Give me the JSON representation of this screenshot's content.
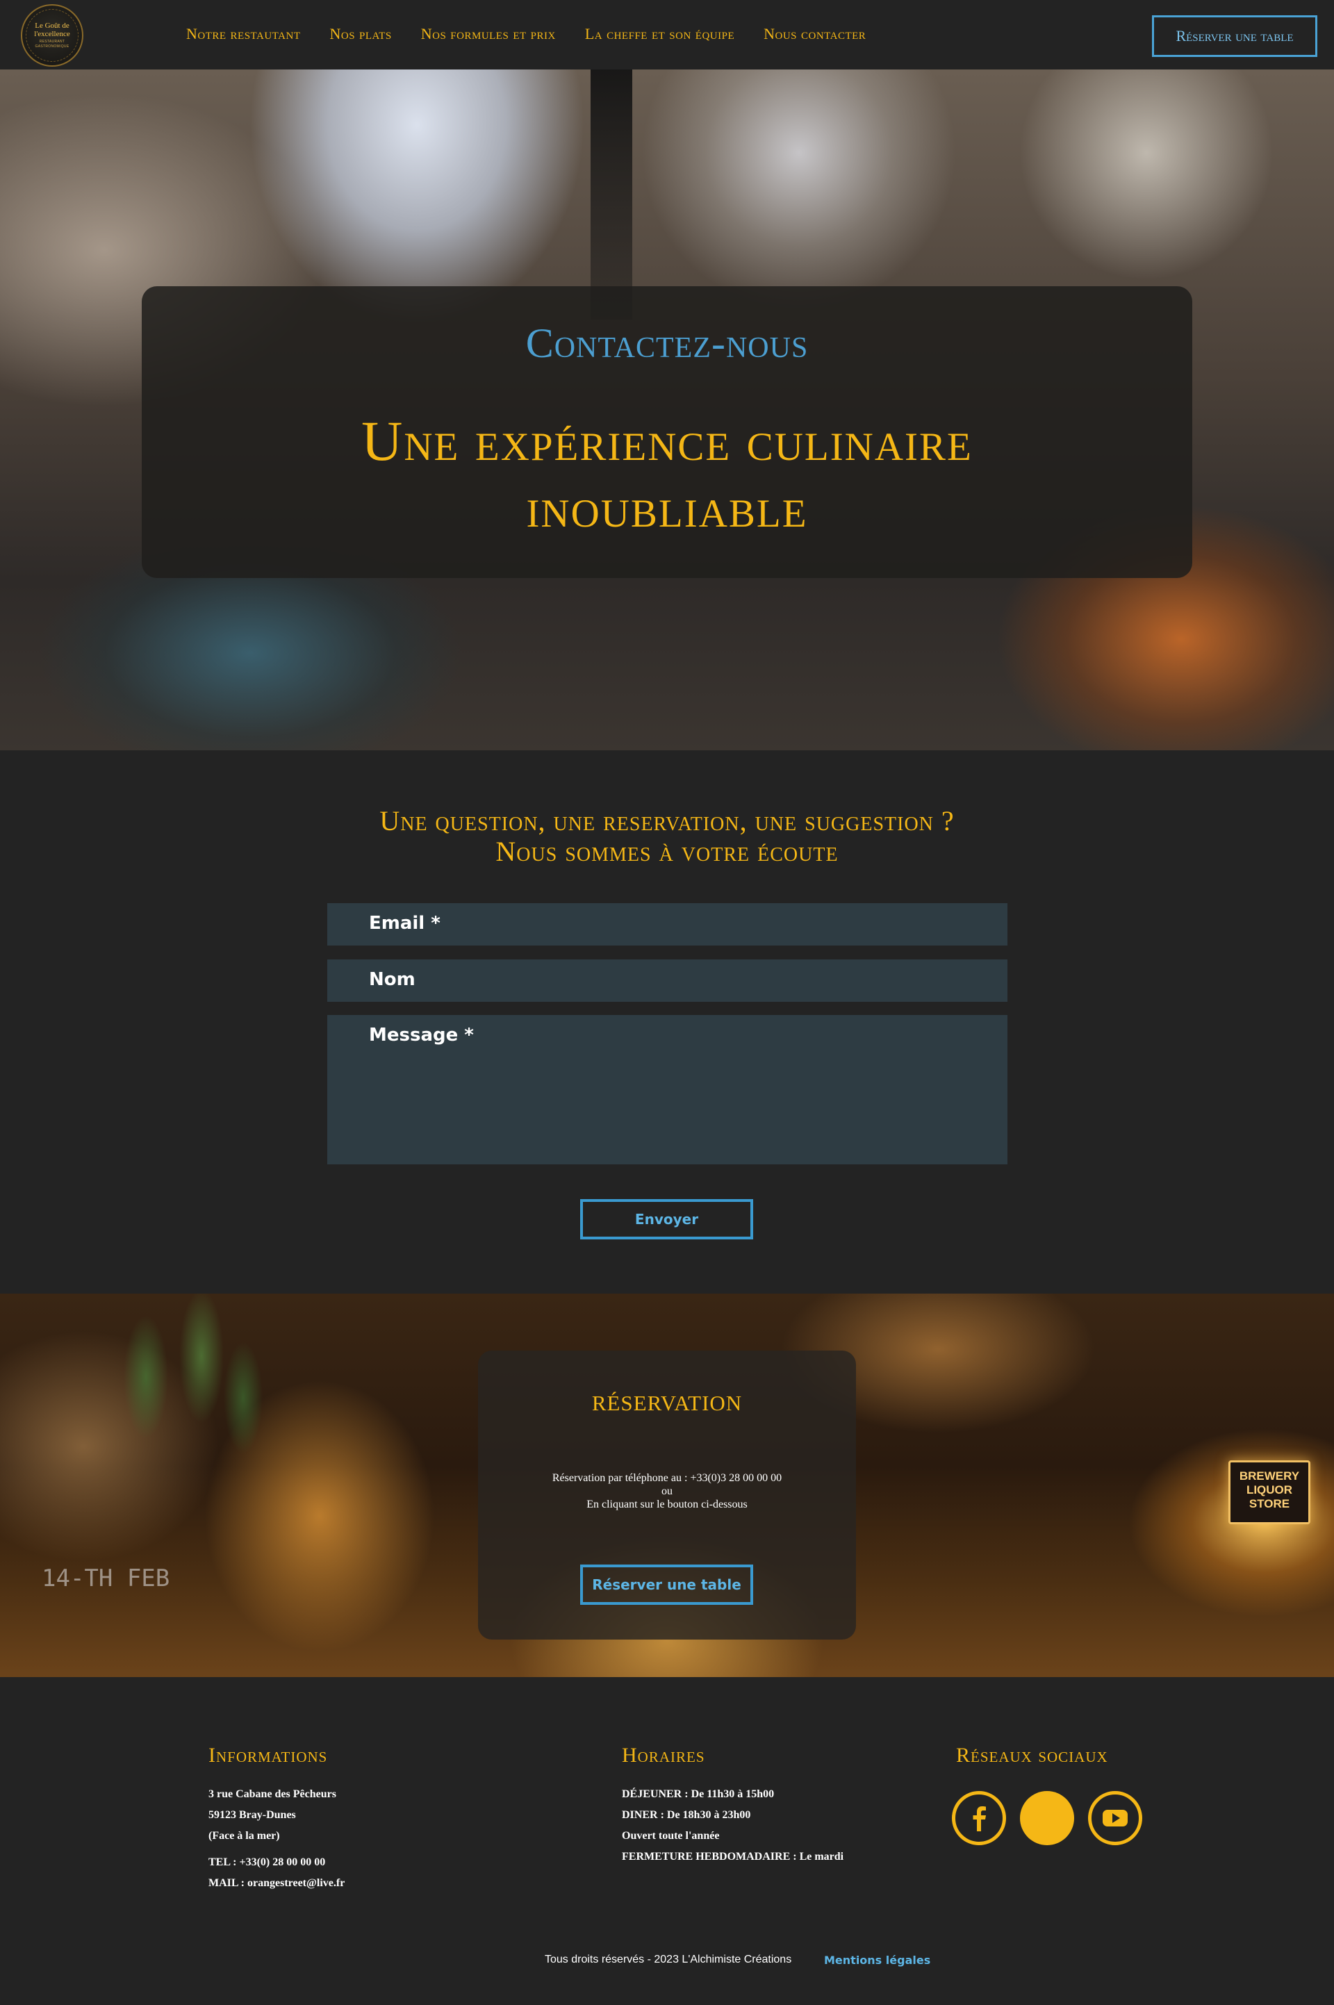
{
  "nav": {
    "logo_line1": "Le Goût de",
    "logo_line2": "l'excellence",
    "logo_tagline": "RESTAURANT GASTRONOMIQUE",
    "links": [
      "Notre restautant",
      "Nos plats",
      "Nos formules et prix",
      "La cheffe et son équipe",
      "Nous contacter"
    ],
    "cta": "Réserver une table"
  },
  "hero": {
    "kicker": "Contactez-nous",
    "title": "Une expérience culinaire inoubliable"
  },
  "contact": {
    "heading_line1": "Une question, une reservation, une suggestion ?",
    "heading_line2": "Nous sommes à votre écoute",
    "email_placeholder": "Email *",
    "name_placeholder": "Nom",
    "message_placeholder": "Message *",
    "submit": "Envoyer"
  },
  "reservation": {
    "title": "réservation",
    "line1": "Réservation par téléphone au : +33(0)3 28 00 00 00",
    "line2": "ou",
    "line3": "En cliquant sur le bouton ci-dessous",
    "button": "Réserver une table",
    "sign": "BREWERY LIQUOR STORE",
    "chalk": "14-TH FEB"
  },
  "footer": {
    "info_title": "Informations",
    "address1": "3 rue Cabane des Pêcheurs",
    "address2": "59123 Bray-Dunes",
    "address3": "(Face à la mer)",
    "tel": "TEL : +33(0) 28 00 00 00",
    "mail": "MAIL : orangestreet@live.fr",
    "hours_title": "Horaires",
    "lunch": "DÉJEUNER : De 11h30 à 15h00",
    "dinner": "DINER : De 18h30 à 23h00",
    "open": "Ouvert toute l'année",
    "closing": "FERMETURE HEBDOMADAIRE : Le mardi",
    "social_title": "Réseaux sociaux",
    "social_icons": [
      "facebook-icon",
      "instagram-icon",
      "youtube-icon"
    ],
    "copyright": "Tous droits réservés - 2023 L'Alchimiste Créations",
    "legal": "Mentions légales"
  },
  "colors": {
    "accent": "#f5b716",
    "link": "#4aa3d6",
    "background": "#232323",
    "field": "#2e3c43"
  }
}
